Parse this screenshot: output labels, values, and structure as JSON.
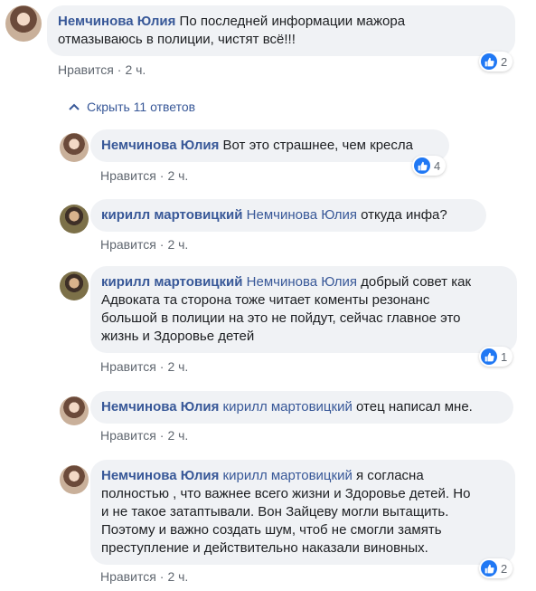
{
  "main_comment": {
    "author": "Немчинова Юлия",
    "text_line1": "По последней информации мажора",
    "text_line2": "отмазываюсь в полиции, чистят всё!!!",
    "like_label": "Нравится",
    "time": "2 ч.",
    "reaction_count": "2"
  },
  "replies_toggle": {
    "label": "Скрыть 11 ответов",
    "icon": "chevron-up-icon"
  },
  "replies": [
    {
      "author": "Немчинова Юлия",
      "text": "Вот это страшнее, чем кресла",
      "like_label": "Нравится",
      "time": "2 ч.",
      "reaction_count": "4"
    },
    {
      "author": "кирилл мартовицкий",
      "mention": "Немчинова Юлия",
      "text": "откуда инфа?",
      "like_label": "Нравится",
      "time": "2 ч."
    },
    {
      "author": "кирилл мартовицкий",
      "mention": "Немчинова Юлия",
      "text_line1": "добрый совет как",
      "text_line2": "Адвоката та сторона тоже читает коменты резонанс",
      "text_line3": "большой в полиции на это не пойдут, сейчас главное это",
      "text_line4": "жизнь и Здоровье детей",
      "like_label": "Нравится",
      "time": "2 ч.",
      "reaction_count": "1"
    },
    {
      "author": "Немчинова Юлия",
      "mention": "кирилл мартовицкий",
      "text": "отец написал мне.",
      "like_label": "Нравится",
      "time": "2 ч."
    },
    {
      "author": "Немчинова Юлия",
      "mention": "кирилл мартовицкий",
      "text_line1": "я согласна",
      "text_line2": "полностью , что важнее всего жизни и Здоровье детей. Но",
      "text_line3": "и не такое затаптывали. Вон Зайцеву могли вытащить.",
      "text_line4": "Поэтому и важно создать шум, чтоб не смогли замять",
      "text_line5": "преступление и действительно наказали виновных.",
      "like_label": "Нравится",
      "time": "2 ч.",
      "reaction_count": "2"
    }
  ],
  "colors": {
    "link": "#385898",
    "bubble": "#f0f2f5",
    "like": "#2078f4",
    "meta": "#606770"
  }
}
